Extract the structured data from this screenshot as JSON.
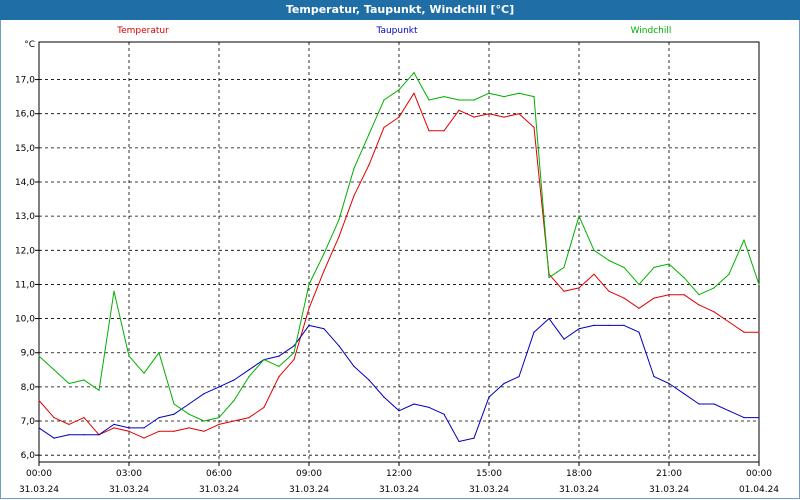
{
  "window": {
    "title": "Temperatur, Taupunkt, Windchill [°C]"
  },
  "chart_data": {
    "type": "line",
    "title": "Temperatur, Taupunkt, Windchill [°C]",
    "ylabel": "°C",
    "ylim": [
      5.8,
      18.1
    ],
    "y_ticks": [
      "6,0",
      "7,0",
      "8,0",
      "9,0",
      "10,0",
      "11,0",
      "12,0",
      "13,0",
      "14,0",
      "15,0",
      "16,0",
      "17,0"
    ],
    "x_ticks": [
      {
        "time": "00:00",
        "date": "31.03.24"
      },
      {
        "time": "03:00",
        "date": "31.03.24"
      },
      {
        "time": "06:00",
        "date": "31.03.24"
      },
      {
        "time": "09:00",
        "date": "31.03.24"
      },
      {
        "time": "12:00",
        "date": "31.03.24"
      },
      {
        "time": "15:00",
        "date": "31.03.24"
      },
      {
        "time": "18:00",
        "date": "31.03.24"
      },
      {
        "time": "21:00",
        "date": "31.03.24"
      },
      {
        "time": "00:00",
        "date": "01.04.24"
      }
    ],
    "grid": true,
    "legend_position": "top",
    "x_hours": [
      0,
      0.5,
      1,
      1.5,
      2,
      2.5,
      3,
      3.5,
      4,
      4.5,
      5,
      5.5,
      6,
      6.5,
      7,
      7.5,
      8,
      8.5,
      9,
      9.5,
      10,
      10.5,
      11,
      11.5,
      12,
      12.5,
      13,
      13.5,
      14,
      14.5,
      15,
      15.5,
      16,
      16.5,
      17,
      17.5,
      18,
      18.5,
      19,
      19.5,
      20,
      20.5,
      21,
      21.5,
      22,
      22.5,
      23,
      23.5,
      24
    ],
    "series": [
      {
        "name": "Temperatur",
        "color": "#e00000",
        "values": [
          7.6,
          7.1,
          6.9,
          7.1,
          6.6,
          6.8,
          6.7,
          6.5,
          6.7,
          6.7,
          6.8,
          6.7,
          6.9,
          7.0,
          7.1,
          7.4,
          8.3,
          8.8,
          10.3,
          11.4,
          12.4,
          13.6,
          14.5,
          15.6,
          15.9,
          16.6,
          15.5,
          15.5,
          16.1,
          15.9,
          16.0,
          15.9,
          16.0,
          15.6,
          11.3,
          10.8,
          10.9,
          11.3,
          10.8,
          10.6,
          10.3,
          10.6,
          10.7,
          10.7,
          10.4,
          10.2,
          9.9,
          9.6,
          9.6
        ]
      },
      {
        "name": "Taupunkt",
        "color": "#0000c0",
        "values": [
          6.8,
          6.5,
          6.6,
          6.6,
          6.6,
          6.9,
          6.8,
          6.8,
          7.1,
          7.2,
          7.5,
          7.8,
          8.0,
          8.2,
          8.5,
          8.8,
          8.9,
          9.2,
          9.8,
          9.7,
          9.2,
          8.6,
          8.2,
          7.7,
          7.3,
          7.5,
          7.4,
          7.2,
          6.4,
          6.5,
          7.7,
          8.1,
          8.3,
          9.6,
          10.0,
          9.4,
          9.7,
          9.8,
          9.8,
          9.8,
          9.6,
          8.3,
          8.1,
          7.8,
          7.5,
          7.5,
          7.3,
          7.1,
          7.1
        ]
      },
      {
        "name": "Windchill",
        "color": "#00b000",
        "values": [
          8.9,
          8.5,
          8.1,
          8.2,
          7.9,
          10.8,
          8.9,
          8.4,
          9.0,
          7.5,
          7.2,
          7.0,
          7.1,
          7.6,
          8.3,
          8.8,
          8.6,
          9.0,
          11.0,
          11.9,
          12.9,
          14.4,
          15.4,
          16.4,
          16.7,
          17.2,
          16.4,
          16.5,
          16.4,
          16.4,
          16.6,
          16.5,
          16.6,
          16.5,
          11.2,
          11.5,
          13.0,
          12.0,
          11.7,
          11.5,
          11.0,
          11.5,
          11.6,
          11.2,
          10.7,
          10.9,
          11.3,
          12.3,
          11.0
        ]
      }
    ]
  }
}
